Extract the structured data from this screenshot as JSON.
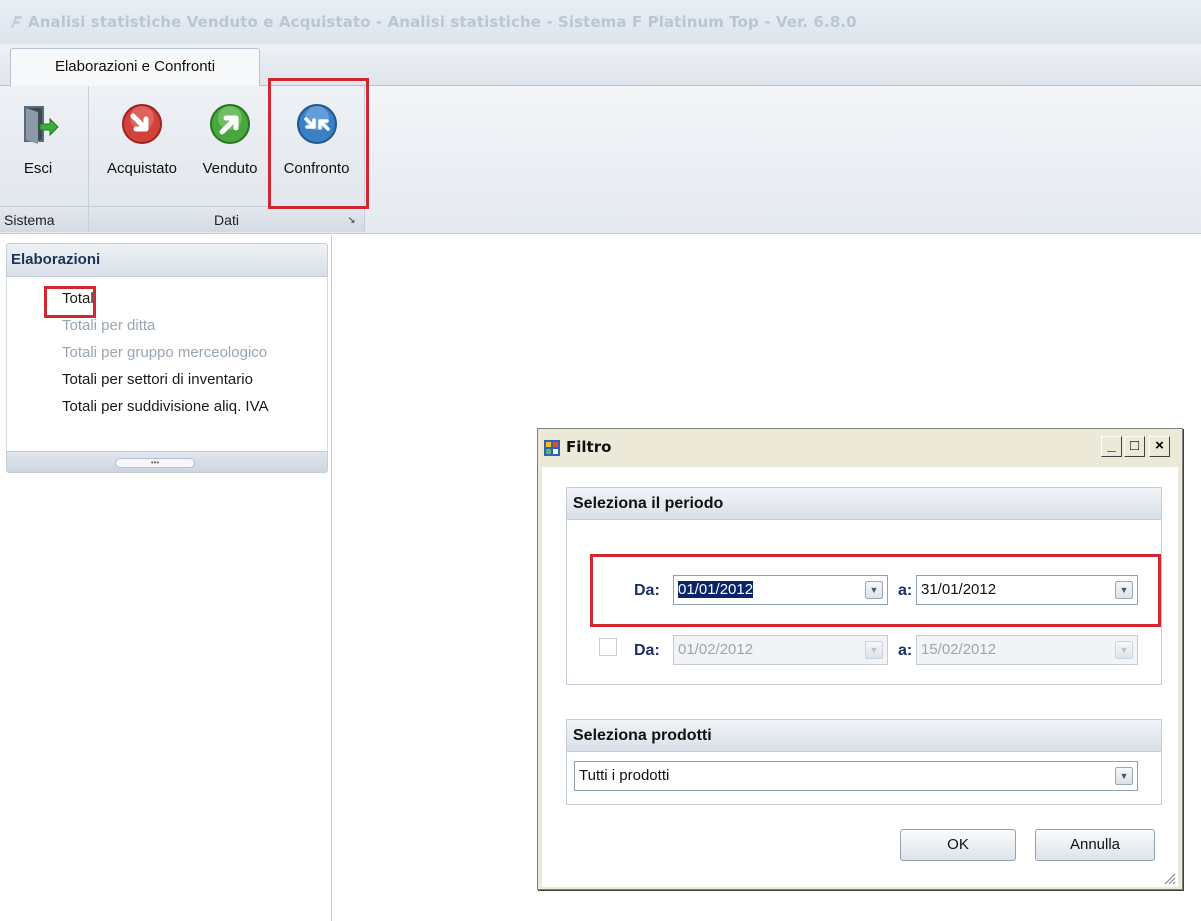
{
  "window": {
    "title": "Analisi statistiche Venduto e Acquistato - Analisi statistiche - Sistema F Platinum Top - Ver. 6.8.0",
    "app_icon": "f-logo-icon"
  },
  "tabs": [
    {
      "label": "Elaborazioni e Confronti",
      "active": true
    }
  ],
  "ribbon": {
    "groups": [
      {
        "label": "Sistema",
        "buttons": [
          {
            "label": "Esci",
            "icon": "exit-door-icon"
          }
        ]
      },
      {
        "label": "Dati",
        "buttons": [
          {
            "label": "Acquistato",
            "icon": "red-arrow-down-icon"
          },
          {
            "label": "Venduto",
            "icon": "green-arrow-up-icon"
          },
          {
            "label": "Confronto",
            "icon": "blue-swap-arrows-icon",
            "highlighted": true
          }
        ]
      }
    ]
  },
  "sidebar": {
    "header": "Elaborazioni",
    "items": [
      {
        "label": "Totali",
        "enabled": true,
        "highlighted": true
      },
      {
        "label": "Totali per ditta",
        "enabled": false
      },
      {
        "label": "Totali per gruppo merceologico",
        "enabled": false
      },
      {
        "label": "Totali per settori di inventario",
        "enabled": true
      },
      {
        "label": "Totali per suddivisione aliq. IVA",
        "enabled": true
      }
    ]
  },
  "dialog": {
    "title": "Filtro",
    "controls": {
      "minimize": "_",
      "maximize": "□",
      "close": "×"
    },
    "period_section": {
      "header": "Seleziona il periodo",
      "row1": {
        "from_label": "Da:",
        "from_value": "01/01/2012",
        "from_selected": "01/01/2012",
        "to_label": "a:",
        "to_value": "31/01/2012"
      },
      "row2": {
        "checked": false,
        "from_label": "Da:",
        "from_value": "01/02/2012",
        "to_label": "a:",
        "to_value": "15/02/2012"
      }
    },
    "products_section": {
      "header": "Seleziona prodotti",
      "value": "Tutti i prodotti"
    },
    "buttons": {
      "ok": "OK",
      "cancel": "Annulla"
    }
  },
  "colors": {
    "highlight": "#d22630",
    "header_text": "#1b3556",
    "label_blue": "#1b2f66"
  }
}
